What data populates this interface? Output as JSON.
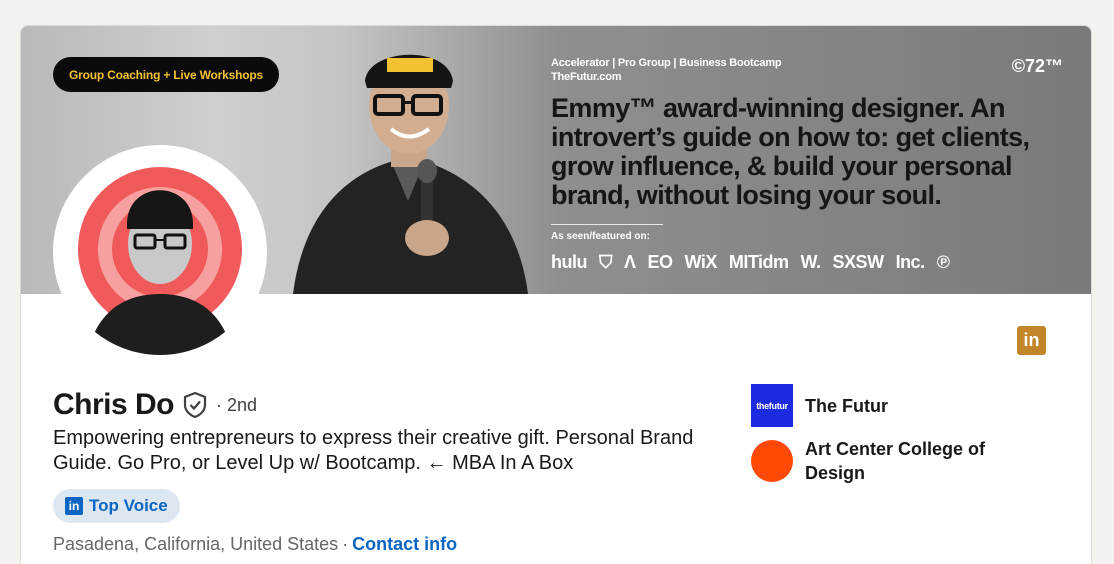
{
  "banner": {
    "pill": "Group Coaching + Live Workshops",
    "sub_line1": "Accelerator  |  Pro Group  |  Business Bootcamp",
    "sub_line2": "TheFutur.com",
    "brand_72": "©72™",
    "headline": "Emmy™ award-winning designer. An introvert’s guide on how to: get clients, grow influence, & build your personal brand, without losing your soul.",
    "seen_label": "As seen/featured on:",
    "logos": [
      "hulu",
      "⛉",
      "Λ",
      "EO",
      "WiX",
      "MITidm",
      "W.",
      "SXSW",
      "Inc.",
      "℗"
    ]
  },
  "profile": {
    "name": "Chris Do",
    "degree": "· 2nd",
    "headline": "Empowering entrepreneurs to express their creative gift. Personal Brand Guide. Go Pro, or Level Up w/ Bootcamp. ← MBA In A Box",
    "top_voice_label": "Top Voice",
    "location": "Pasadena, California, United States",
    "separator": "·",
    "contact_label": "Contact info",
    "linkedin_mark": "in"
  },
  "organizations": [
    {
      "name": "The Futur",
      "logo_text": "thefutur",
      "color": "#1c2bdf"
    },
    {
      "name": "Art Center College of Design",
      "color": "#ff4a07"
    }
  ]
}
